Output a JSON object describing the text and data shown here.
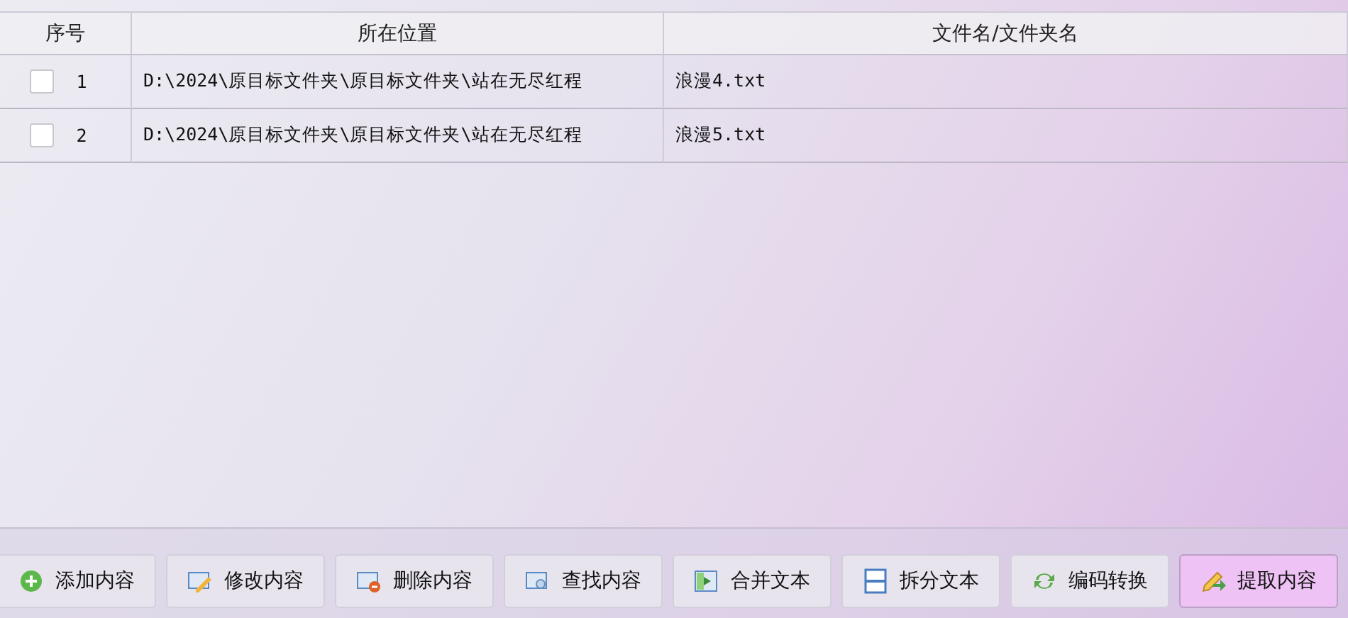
{
  "table": {
    "columns": [
      "序号",
      "所在位置",
      "文件名/文件夹名"
    ],
    "rows": [
      {
        "checked": false,
        "index": "1",
        "location": "D:\\2024\\原目标文件夹\\原目标文件夹\\站在无尽红程",
        "name": "浪漫4.txt"
      },
      {
        "checked": false,
        "index": "2",
        "location": "D:\\2024\\原目标文件夹\\原目标文件夹\\站在无尽红程",
        "name": "浪漫5.txt"
      }
    ]
  },
  "buttons": [
    {
      "kind": "add",
      "label": "添加内容",
      "highlighted": false
    },
    {
      "kind": "edit",
      "label": "修改内容",
      "highlighted": false
    },
    {
      "kind": "delete",
      "label": "删除内容",
      "highlighted": false
    },
    {
      "kind": "find",
      "label": "查找内容",
      "highlighted": false
    },
    {
      "kind": "merge",
      "label": "合并文本",
      "highlighted": false
    },
    {
      "kind": "split",
      "label": "拆分文本",
      "highlighted": false
    },
    {
      "kind": "convert",
      "label": "编码转换",
      "highlighted": false
    },
    {
      "kind": "extract",
      "label": "提取内容",
      "highlighted": true
    }
  ]
}
